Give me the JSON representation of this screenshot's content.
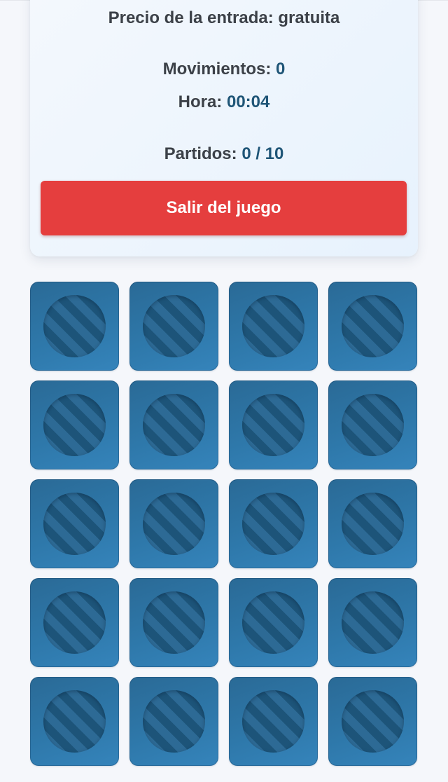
{
  "stats": {
    "price_label": "Precio de la entrada: ",
    "price_value": "gratuita",
    "moves_label": "Movimientos: ",
    "moves_value": "0",
    "time_label": "Hora: ",
    "time_value": "00:04",
    "pairs_label": "Partidos: ",
    "pairs_value": "0 / 10"
  },
  "actions": {
    "exit_label": "Salir del juego"
  },
  "board": {
    "rows": 5,
    "columns": 4,
    "card_back_icon": "striped-circle-icon",
    "colors": {
      "card": "#2e78aa",
      "emblem_dark": "#1d5479",
      "emblem_light": "#2d6a95",
      "exit_button": "#e53e3e",
      "stat_value": "#1f5577"
    }
  }
}
